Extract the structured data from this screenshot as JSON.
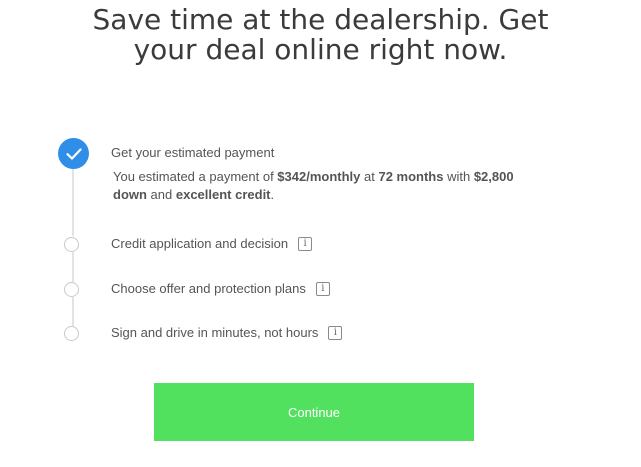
{
  "headline": {
    "line1": "Save time at the dealership. Get",
    "line2": "your deal online right now."
  },
  "steps": [
    {
      "label": "Get your estimated payment",
      "status": "complete",
      "icon": "checkmark-icon"
    },
    {
      "label": "Credit application and decision",
      "status": "pending",
      "info_icon": "i"
    },
    {
      "label": "Choose offer and protection plans",
      "status": "pending",
      "info_icon": "i"
    },
    {
      "label": "Sign and drive in minutes, not hours",
      "status": "pending",
      "info_icon": "i"
    }
  ],
  "summary": {
    "prefix": "You estimated a payment of ",
    "payment": "$342/monthly",
    "at": " at ",
    "term": "72 months",
    "with": " with ",
    "down_amount": "$2,800",
    "down_word": "down",
    "and": " and ",
    "credit": "excellent credit",
    "suffix": "."
  },
  "actions": {
    "continue_label": "Continue"
  },
  "colors": {
    "accent_blue": "#2f8ee8",
    "button_green": "#52e05f",
    "text": "#555555"
  }
}
